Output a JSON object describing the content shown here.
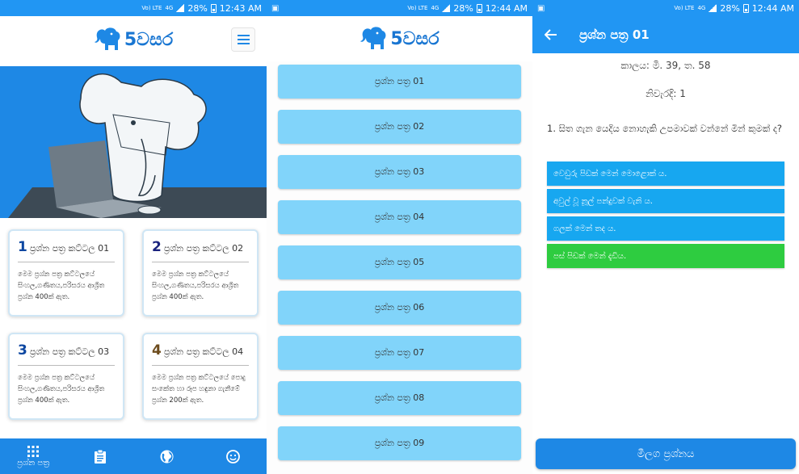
{
  "status_bars": [
    {
      "time": "12:43 AM",
      "battery": "28%",
      "network": "4G",
      "carrier": "Vo) LTE"
    },
    {
      "time": "12:44 AM",
      "battery": "28%",
      "network": "4G",
      "carrier": "Vo) LTE"
    },
    {
      "time": "12:44 AM",
      "battery": "28%",
      "network": "4G",
      "carrier": "Vo) LTE"
    }
  ],
  "app": {
    "logo_text": "5වසර",
    "brand_color": "#1e88e5"
  },
  "home": {
    "cards": [
      {
        "num": "1",
        "num_color": "#0d47a1",
        "title": "ප්‍රශ්න පත්‍ර කට්ටල 01",
        "desc": "මෙම ප්‍රශ්න පත්‍ර කට්ටලයේ සිංහල,ගණිතය,පරිසරය ආශ්‍රිත ප්‍රශ්න 400ක් ඇත."
      },
      {
        "num": "2",
        "num_color": "#1a237e",
        "title": "ප්‍රශ්න පත්‍ර කට්ටල 02",
        "desc": "මෙම ප්‍රශ්න පත්‍ර කට්ටලයේ සිංහල,ගණිතය,පරිසරය ආශ්‍රිත ප්‍රශ්න 400ක් ඇත."
      },
      {
        "num": "3",
        "num_color": "#0d47a1",
        "title": "ප්‍රශ්න පත්‍ර කට්ටල 03",
        "desc": "මෙම ප්‍රශ්න පත්‍ර කට්ටලයේ සිංහල,ගණිතය,පරිසරය ආශ්‍රිත ප්‍රශ්න 400ක් ඇත."
      },
      {
        "num": "4",
        "num_color": "#6d4c1d",
        "title": "ප්‍රශ්න පත්‍ර කට්ටල 04",
        "desc": "මෙම ප්‍රශ්න පත්‍ර කට්ටලයේ පොදු සංකේත හා රූප හඳුනා ගැනීමේ ප්‍රශ්න 200ක් ඇත."
      }
    ],
    "bottom_nav": [
      {
        "icon": "grid-icon",
        "label": "ප්‍රශ්න පත්‍ර"
      },
      {
        "icon": "clipboard-icon",
        "label": ""
      },
      {
        "icon": "globe-icon",
        "label": ""
      },
      {
        "icon": "smiley-icon",
        "label": ""
      }
    ]
  },
  "papers": {
    "items": [
      "ප්‍රශ්න පත්‍ර 01",
      "ප්‍රශ්න පත්‍ර 02",
      "ප්‍රශ්න පත්‍ර 03",
      "ප්‍රශ්න පත්‍ර 04",
      "ප්‍රශ්න පත්‍ර 05",
      "ප්‍රශ්න පත්‍ර 06",
      "ප්‍රශ්න පත්‍ර 07",
      "ප්‍රශ්න පත්‍ර 08",
      "ප්‍රශ්න පත්‍ර 09"
    ]
  },
  "quiz": {
    "title": "ප්‍රශ්න පත්‍ර 01",
    "timer": "කාලය: මි. 39, ත. 58",
    "correct_count": "නිවැරදි: 1",
    "question": "1. සිත ගැන යෙදිය නොහැකි උපමාවක් වන්නේ මින් කුමක් ද?",
    "answers": [
      {
        "text": "වෙඩුරු පිඩක් මෙන් මොළොක් ය.",
        "state": "normal"
      },
      {
        "text": "අවුල් වූ නූල් පන්දුවක් වැනි ය.",
        "state": "normal"
      },
      {
        "text": "ගලක් මෙන් තද ය.",
        "state": "normal"
      },
      {
        "text": "පස් පිඩක් මෙන් දැඩිය.",
        "state": "correct"
      }
    ],
    "next_label": "මීලග ප්‍රශ්නය"
  }
}
